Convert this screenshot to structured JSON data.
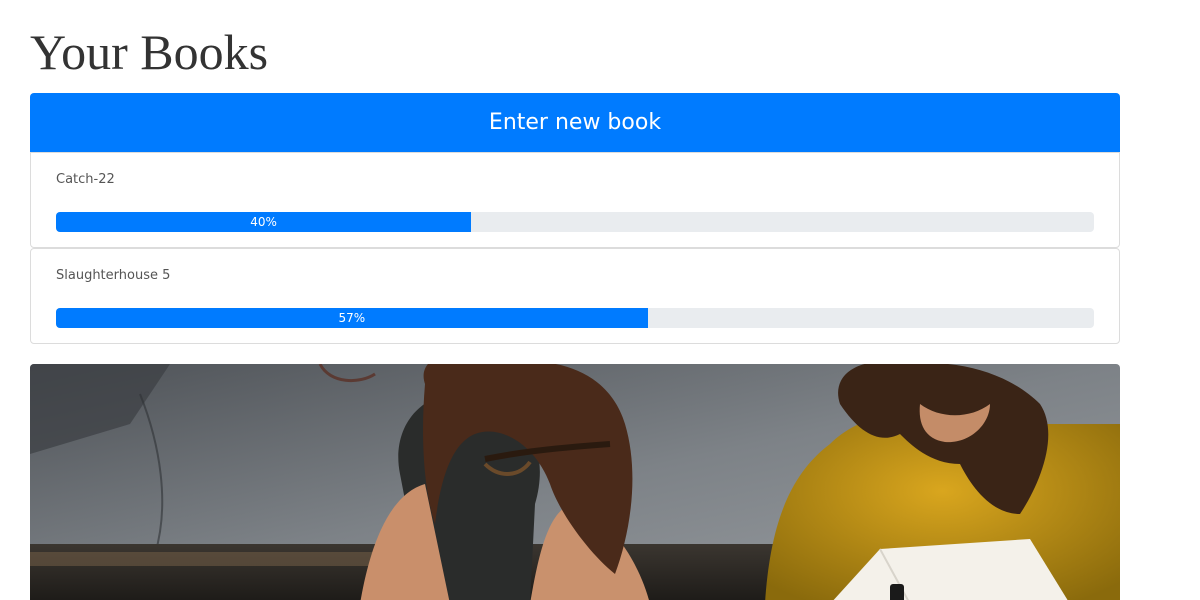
{
  "page": {
    "title": "Your Books"
  },
  "actions": {
    "new_book_label": "Enter new book"
  },
  "books": [
    {
      "title": "Catch-22",
      "progress": 40,
      "progress_label": "40%"
    },
    {
      "title": "Slaughterhouse 5",
      "progress": 57,
      "progress_label": "57%"
    }
  ],
  "colors": {
    "primary": "#007bff",
    "track": "#e9ecef",
    "text": "#333333"
  }
}
